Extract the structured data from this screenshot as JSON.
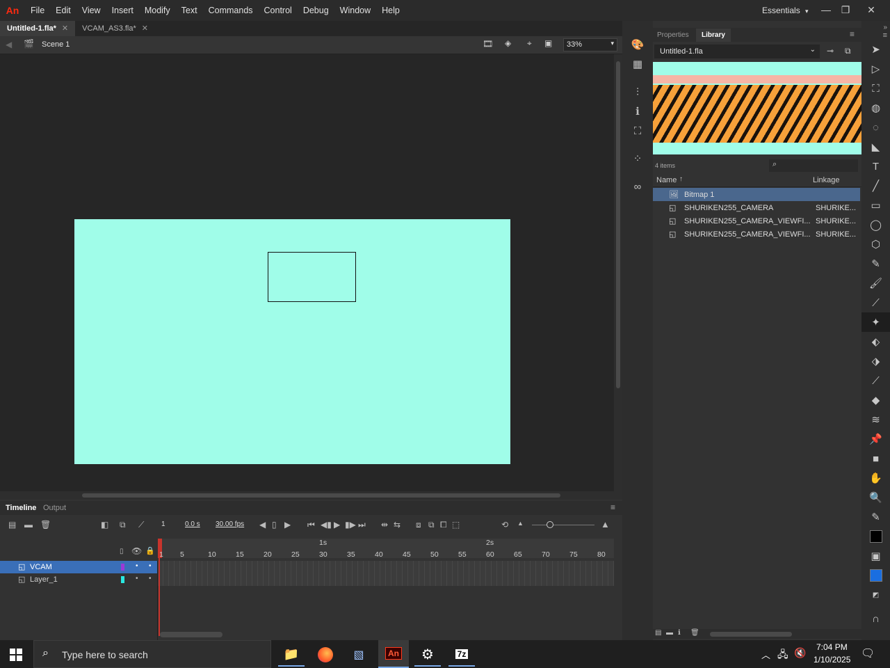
{
  "app": {
    "logo": "An"
  },
  "menu": [
    "File",
    "Edit",
    "View",
    "Insert",
    "Modify",
    "Text",
    "Commands",
    "Control",
    "Debug",
    "Window",
    "Help"
  ],
  "workspace": {
    "label": "Essentials"
  },
  "window_controls": {
    "minimize": "—",
    "restore": "❐",
    "close": "✕"
  },
  "doc_tabs": [
    {
      "label": "Untitled-1.fla*",
      "close": "✕",
      "active": true
    },
    {
      "label": "VCAM_AS3.fla*",
      "close": "✕",
      "active": false
    }
  ],
  "editbar": {
    "scene": "Scene 1",
    "zoom": "33%"
  },
  "stage": {
    "canvas_color": "#a0fde9",
    "bg": "#262626"
  },
  "timeline": {
    "tabs": [
      "Timeline",
      "Output"
    ],
    "frame_field": "1",
    "time": "0.0 s",
    "fps": "30.00 fps",
    "seconds": [
      "1s",
      "2s"
    ],
    "frame_numbers": [
      "1",
      "5",
      "10",
      "15",
      "20",
      "25",
      "30",
      "35",
      "40",
      "45",
      "50",
      "55",
      "60",
      "65",
      "70",
      "75",
      "80"
    ],
    "layers": [
      {
        "name": "VCAM",
        "color": "#9b3ad6",
        "selected": true
      },
      {
        "name": "Layer_1",
        "color": "#29e8e0",
        "selected": false
      }
    ]
  },
  "library": {
    "tabs": [
      "Properties",
      "Library"
    ],
    "document": "Untitled-1.fla",
    "count": "4 items",
    "columns": {
      "name": "Name",
      "linkage": "Linkage"
    },
    "items": [
      {
        "name": "Bitmap 1",
        "linkage": "",
        "selected": true,
        "icon": "bitmap-icon"
      },
      {
        "name": "SHURIKEN255_CAMERA",
        "linkage": "SHURIKE...",
        "selected": false,
        "icon": "movieclip-icon"
      },
      {
        "name": "SHURIKEN255_CAMERA_VIEWFI...",
        "linkage": "SHURIKE...",
        "selected": false,
        "icon": "movieclip-icon"
      },
      {
        "name": "SHURIKEN255_CAMERA_VIEWFI...",
        "linkage": "SHURIKE...",
        "selected": false,
        "icon": "movieclip-icon"
      }
    ]
  },
  "taskbar": {
    "search_placeholder": "Type here to search",
    "time": "7:04 PM",
    "date": "1/10/2025",
    "apps": [
      "file-explorer-icon",
      "firefox-icon",
      "editor-icon",
      "animate-icon",
      "settings-icon",
      "7zip-icon"
    ],
    "animate_label": "An",
    "zip_label": "7z"
  }
}
